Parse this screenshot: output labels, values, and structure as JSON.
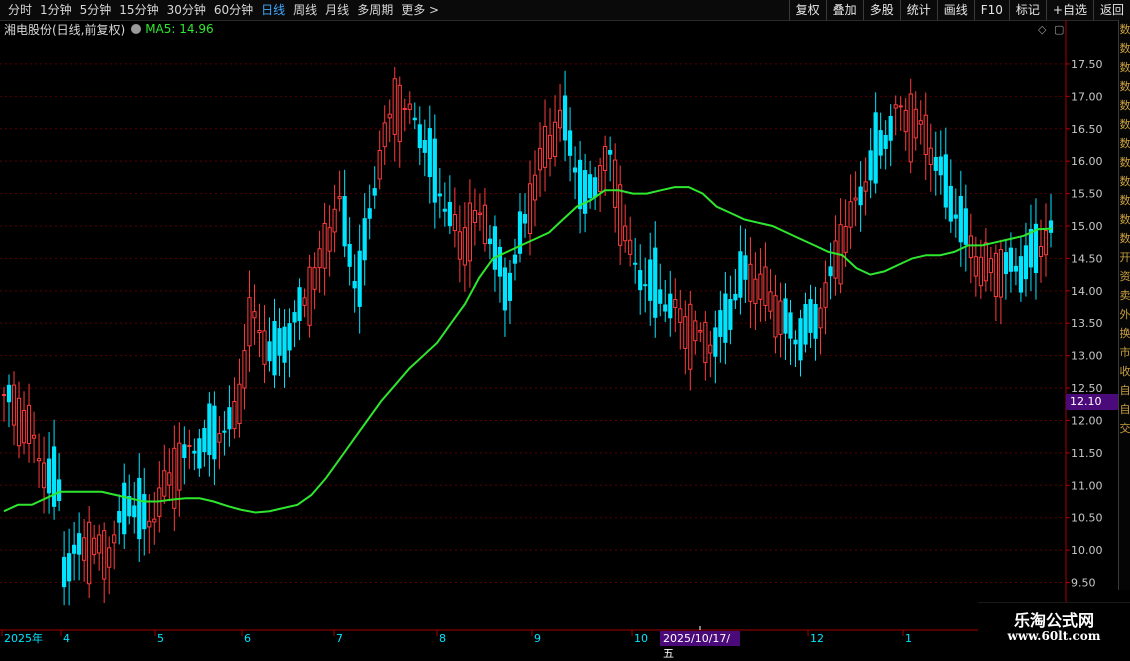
{
  "toolbar": {
    "periods": [
      "分时",
      "1分钟",
      "5分钟",
      "15分钟",
      "30分钟",
      "60分钟",
      "日线",
      "周线",
      "月线",
      "多周期",
      "更多 >"
    ],
    "active_period": "日线",
    "right_buttons": [
      "复权",
      "叠加",
      "多股",
      "统计",
      "画线",
      "F10",
      "标记",
      "+自选",
      "返回"
    ]
  },
  "title": {
    "stock": "湘电股份(日线,前复权)",
    "ma_label": "MA5: 14.96"
  },
  "axis": {
    "price_labels": [
      "17.50",
      "17.00",
      "16.50",
      "16.00",
      "15.50",
      "15.00",
      "14.50",
      "14.00",
      "13.50",
      "13.00",
      "12.50",
      "12.00",
      "11.50",
      "11.00",
      "10.50",
      "10.00",
      "9.50"
    ],
    "current_price_tag": "12.10",
    "month_labels": [
      "2025年",
      "4",
      "5",
      "6",
      "7",
      "8",
      "9",
      "10",
      "12",
      "1"
    ],
    "crosshair_date": "2025/10/17/五"
  },
  "side_panel": {
    "chars": [
      "数",
      "数",
      "数",
      "数",
      "数",
      "数",
      "数",
      "数",
      "数",
      "数",
      "数",
      "数",
      "开",
      "资",
      "卖",
      "外",
      "换",
      "市",
      "收",
      "自",
      "自",
      "交"
    ]
  },
  "watermark": {
    "title": "乐淘公式网",
    "url": "www.60lt.com"
  },
  "colors": {
    "up": "#ff3c3c",
    "down": "#00e5ff",
    "ma": "#2ee62e",
    "grid": "#5a0000",
    "axis_text": "#c8c8c8",
    "highlight": "#4b0a7a"
  },
  "chart_data": {
    "type": "candlestick",
    "ma_series": {
      "name": "MA5",
      "last_value": 14.96,
      "values": [
        10.6,
        10.7,
        10.7,
        10.8,
        10.9,
        10.9,
        10.9,
        10.9,
        10.85,
        10.8,
        10.75,
        10.75,
        10.78,
        10.8,
        10.8,
        10.75,
        10.68,
        10.62,
        10.58,
        10.6,
        10.65,
        10.7,
        10.85,
        11.1,
        11.4,
        11.7,
        12.0,
        12.3,
        12.55,
        12.8,
        13.0,
        13.2,
        13.5,
        13.8,
        14.2,
        14.5,
        14.6,
        14.7,
        14.8,
        14.9,
        15.1,
        15.3,
        15.4,
        15.55,
        15.55,
        15.5,
        15.5,
        15.55,
        15.6,
        15.6,
        15.5,
        15.3,
        15.2,
        15.1,
        15.05,
        15.0,
        14.9,
        14.8,
        14.7,
        14.6,
        14.55,
        14.35,
        14.25,
        14.3,
        14.4,
        14.5,
        14.55,
        14.55,
        14.6,
        14.7,
        14.7,
        14.75,
        14.8,
        14.85,
        14.95,
        14.96
      ]
    },
    "y_range": [
      9.2,
      17.9
    ]
  }
}
